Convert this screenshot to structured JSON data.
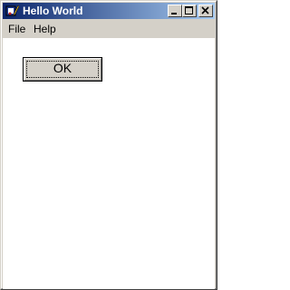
{
  "window": {
    "title": "Hello World"
  },
  "menu": {
    "items": [
      {
        "label": "File"
      },
      {
        "label": "Help"
      }
    ]
  },
  "content": {
    "ok_button_label": "OK"
  },
  "icons": {
    "app": "app-icon",
    "minimize": "minimize-icon",
    "maximize": "maximize-icon",
    "close": "close-icon"
  },
  "colors": {
    "titlebar_start": "#0a246a",
    "titlebar_end": "#a6caf0",
    "face": "#d4d0c8",
    "client": "#ffffff"
  }
}
